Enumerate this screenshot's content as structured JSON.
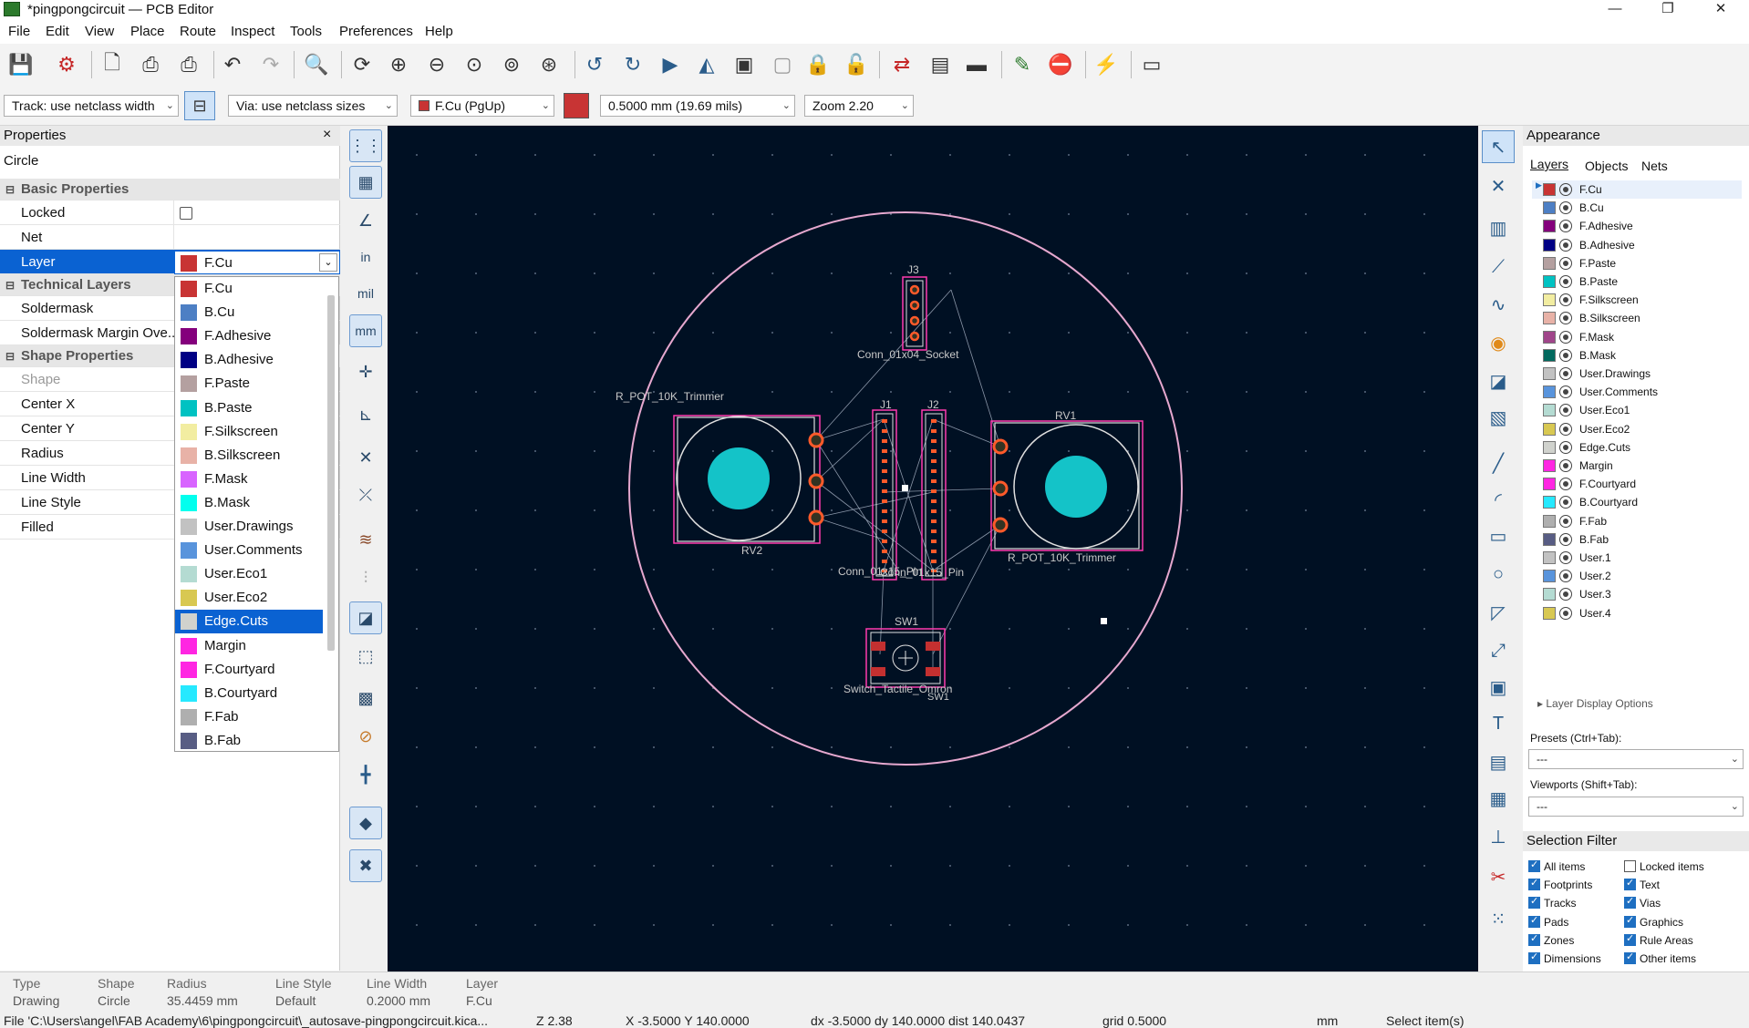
{
  "window": {
    "title": "*pingpongcircuit — PCB Editor",
    "controls": [
      "—",
      "❐",
      "✕"
    ]
  },
  "menu": [
    "File",
    "Edit",
    "View",
    "Place",
    "Route",
    "Inspect",
    "Tools",
    "Preferences",
    "Help"
  ],
  "toolbar": {
    "track_width": "Track: use netclass width",
    "via_size": "Via: use netclass sizes",
    "layer": "F.Cu (PgUp)",
    "grid": "0.5000 mm (19.69 mils)",
    "zoom": "Zoom 2.20"
  },
  "properties": {
    "title": "Properties",
    "close": "×",
    "object_type": "Circle",
    "sections": {
      "basic": "Basic Properties",
      "technical": "Technical Layers",
      "shape": "Shape Properties"
    },
    "rows": {
      "locked": "Locked",
      "net": "Net",
      "layer": "Layer",
      "soldermask": "Soldermask",
      "soldermask_margin": "Soldermask Margin Ove...",
      "shape": "Shape",
      "center_x": "Center X",
      "center_y": "Center Y",
      "radius": "Radius",
      "line_width": "Line Width",
      "line_style": "Line Style",
      "filled": "Filled"
    },
    "layer_value": "F.Cu"
  },
  "layer_dropdown": {
    "selected": "Edge.Cuts",
    "items": [
      {
        "name": "F.Cu",
        "color": "#c83434"
      },
      {
        "name": "B.Cu",
        "color": "#4d7fc4"
      },
      {
        "name": "F.Adhesive",
        "color": "#84007c"
      },
      {
        "name": "B.Adhesive",
        "color": "#000084"
      },
      {
        "name": "F.Paste",
        "color": "#b4a0a0"
      },
      {
        "name": "B.Paste",
        "color": "#00c2c2"
      },
      {
        "name": "F.Silkscreen",
        "color": "#f2eda1"
      },
      {
        "name": "B.Silkscreen",
        "color": "#e8b2a7"
      },
      {
        "name": "F.Mask",
        "color": "#d864ff"
      },
      {
        "name": "B.Mask",
        "color": "#02ffee"
      },
      {
        "name": "User.Drawings",
        "color": "#c2c2c2"
      },
      {
        "name": "User.Comments",
        "color": "#5994dc"
      },
      {
        "name": "User.Eco1",
        "color": "#b4dbd2"
      },
      {
        "name": "User.Eco2",
        "color": "#d8c852"
      },
      {
        "name": "Edge.Cuts",
        "color": "#d0d2cd"
      },
      {
        "name": "Margin",
        "color": "#ff26e2"
      },
      {
        "name": "F.Courtyard",
        "color": "#ff26e2"
      },
      {
        "name": "B.Courtyard",
        "color": "#26e9ff"
      },
      {
        "name": "F.Fab",
        "color": "#afafaf"
      },
      {
        "name": "B.Fab",
        "color": "#585d84"
      }
    ]
  },
  "board": {
    "labels": {
      "j3_ref": "J3",
      "j3_val": "Conn_01x04_Socket",
      "rv2_val": "R_POT_10K_Trimmer",
      "rv2_ref": "RV2",
      "j1_ref": "J1",
      "j2_ref": "J2",
      "j_val": "Conn_01x15_Pin",
      "rv1_ref": "RV1",
      "rv1_val": "R_POT_10K_Trimmer",
      "sw1_ref": "SW1",
      "sw1_val": "Switch_Tactile_Omron",
      "sw1_ref2": "SW1"
    },
    "colors": {
      "background": "#001023",
      "edge": "#e0a0c8",
      "pad": "#ff5a2a",
      "fill": "#14c3c8",
      "courtyard": "#ff26e2"
    }
  },
  "appearance": {
    "title": "Appearance",
    "tabs": [
      "Layers",
      "Objects",
      "Nets"
    ],
    "layers": [
      {
        "name": "F.Cu",
        "color": "#c83434"
      },
      {
        "name": "B.Cu",
        "color": "#4d7fc4"
      },
      {
        "name": "F.Adhesive",
        "color": "#84007c"
      },
      {
        "name": "B.Adhesive",
        "color": "#000084"
      },
      {
        "name": "F.Paste",
        "color": "#b4a0a0"
      },
      {
        "name": "B.Paste",
        "color": "#00c2c2"
      },
      {
        "name": "F.Silkscreen",
        "color": "#f2eda1"
      },
      {
        "name": "B.Silkscreen",
        "color": "#e8b2a7"
      },
      {
        "name": "F.Mask",
        "color": "#a0458a"
      },
      {
        "name": "B.Mask",
        "color": "#02695e"
      },
      {
        "name": "User.Drawings",
        "color": "#c2c2c2"
      },
      {
        "name": "User.Comments",
        "color": "#5994dc"
      },
      {
        "name": "User.Eco1",
        "color": "#b4dbd2"
      },
      {
        "name": "User.Eco2",
        "color": "#d8c852"
      },
      {
        "name": "Edge.Cuts",
        "color": "#d0d2cd"
      },
      {
        "name": "Margin",
        "color": "#ff26e2"
      },
      {
        "name": "F.Courtyard",
        "color": "#ff26e2"
      },
      {
        "name": "B.Courtyard",
        "color": "#26e9ff"
      },
      {
        "name": "F.Fab",
        "color": "#afafaf"
      },
      {
        "name": "B.Fab",
        "color": "#585d84"
      },
      {
        "name": "User.1",
        "color": "#c2c2c2"
      },
      {
        "name": "User.2",
        "color": "#5994dc"
      },
      {
        "name": "User.3",
        "color": "#b4dbd2"
      },
      {
        "name": "User.4",
        "color": "#d8c852"
      }
    ],
    "layer_display_options": "Layer Display Options",
    "presets_label": "Presets (Ctrl+Tab):",
    "presets_value": "---",
    "viewports_label": "Viewports (Shift+Tab):",
    "viewports_value": "---"
  },
  "selection_filter": {
    "title": "Selection Filter",
    "items": [
      {
        "label": "All items",
        "checked": true
      },
      {
        "label": "Locked items",
        "checked": false
      },
      {
        "label": "Footprints",
        "checked": true
      },
      {
        "label": "Text",
        "checked": true
      },
      {
        "label": "Tracks",
        "checked": true
      },
      {
        "label": "Vias",
        "checked": true
      },
      {
        "label": "Pads",
        "checked": true
      },
      {
        "label": "Graphics",
        "checked": true
      },
      {
        "label": "Zones",
        "checked": true
      },
      {
        "label": "Rule Areas",
        "checked": true
      },
      {
        "label": "Dimensions",
        "checked": true
      },
      {
        "label": "Other items",
        "checked": true
      }
    ]
  },
  "status": {
    "keys": [
      "Type",
      "Shape",
      "Radius",
      "Line Style",
      "Line Width",
      "Layer"
    ],
    "values": [
      "Drawing",
      "Circle",
      "35.4459 mm",
      "Default",
      "0.2000 mm",
      "F.Cu"
    ],
    "file": "File 'C:\\Users\\angel\\FAB Academy\\6\\pingpongcircuit\\_autosave-pingpongcircuit.kica...",
    "zoom": "Z 2.38",
    "xy": "X -3.5000  Y 140.0000",
    "delta": "dx -3.5000  dy 140.0000  dist 140.0437",
    "grid": "grid 0.5000",
    "units": "mm",
    "mode": "Select item(s)"
  }
}
